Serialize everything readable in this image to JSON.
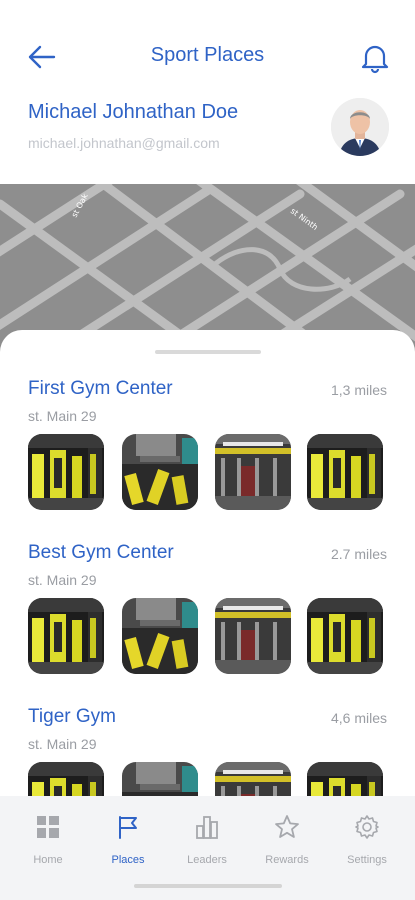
{
  "header": {
    "title": "Sport Places",
    "back_icon": "arrow-left-icon",
    "notification_icon": "bell-icon",
    "accent_color": "#2f63c6"
  },
  "user": {
    "name": "Michael Johnathan Doe",
    "email": "michael.johnathan@gmail.com"
  },
  "map": {
    "street_labels": [
      "st Oak",
      "st Ninth"
    ]
  },
  "places": [
    {
      "name": "First Gym Center",
      "distance": "1,3 miles",
      "address": "st. Main 29"
    },
    {
      "name": "Best Gym Center",
      "distance": "2.7 miles",
      "address": "st. Main 29"
    },
    {
      "name": "Tiger Gym",
      "distance": "4,6 miles",
      "address": "st. Main 29"
    }
  ],
  "tabbar": {
    "active": "Places",
    "items": [
      {
        "label": "Home",
        "icon": "grid-icon"
      },
      {
        "label": "Places",
        "icon": "flag-icon"
      },
      {
        "label": "Leaders",
        "icon": "bar-chart-icon"
      },
      {
        "label": "Rewards",
        "icon": "star-icon"
      },
      {
        "label": "Settings",
        "icon": "gear-icon"
      }
    ]
  }
}
